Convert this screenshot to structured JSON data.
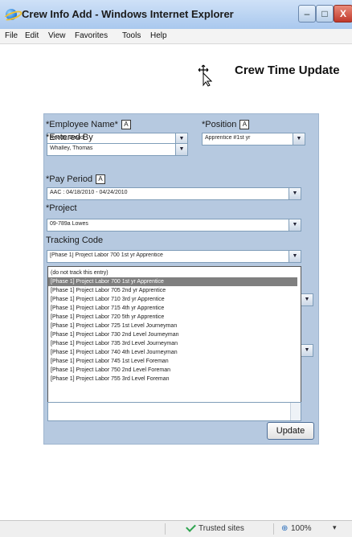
{
  "window": {
    "title": "Crew Info Add - Windows Internet Explorer"
  },
  "menu": {
    "items": [
      "File",
      "Edit",
      "View",
      "Favorites",
      "Tools",
      "Help"
    ]
  },
  "page": {
    "title": "Crew Time Update"
  },
  "form": {
    "employee_name": {
      "label": "*Employee Name*",
      "value": "Reeds, David"
    },
    "position": {
      "label": "*Position",
      "value": "Apprentice #1st yr"
    },
    "entered_by": {
      "label": "*Entered By",
      "value": "Whalley, Thomas"
    },
    "pay_period": {
      "label": "*Pay Period",
      "value": "AAC : 04/18/2010 - 04/24/2010"
    },
    "project": {
      "label": "*Project",
      "value": "09-789a  Lowes"
    },
    "tracking_code": {
      "label": "Tracking Code",
      "value": "[Phase 1] Project Labor 700 1st yr Apprentice",
      "options": [
        "(do not track this entry)",
        "[Phase 1] Project Labor 700 1st yr Apprentice",
        "[Phase 1] Project Labor 705 2nd yr Apprentice",
        "[Phase 1] Project Labor 710 3rd yr Apprentice",
        "[Phase 1] Project Labor 715 4th yr Apprentice",
        "[Phase 1] Project Labor 720 5th yr Apprentice",
        "[Phase 1] Project Labor 725 1st Level Journeyman",
        "[Phase 1] Project Labor 730 2nd Level Journeyman",
        "[Phase 1] Project Labor 735 3rd Level Journeyman",
        "[Phase 1] Project Labor 740 4th Level Journeyman",
        "[Phase 1] Project Labor 745 1st Level Foreman",
        "[Phase 1] Project Labor 750 2nd Level Foreman",
        "[Phase 1] Project Labor 755 3rd Level Foreman"
      ],
      "highlighted_index": 1
    },
    "a_marker": "A",
    "update_label": "Update"
  },
  "icons": {
    "dropdown_arrow": "▼",
    "minimize": "–",
    "maximize": "□",
    "close": "X"
  },
  "status": {
    "zone": "Trusted sites",
    "zoom": "100%"
  },
  "colors": {
    "panel": "#b6c9e0",
    "highlight": "#7f7f7f",
    "titlebar": "#a9c8ee"
  }
}
